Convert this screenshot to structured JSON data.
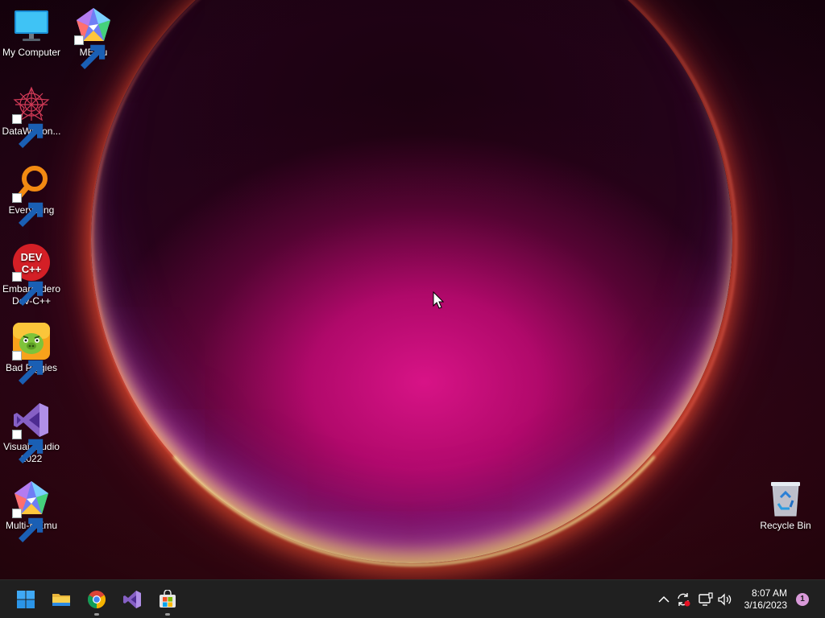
{
  "desktop": {
    "icons": [
      {
        "label": "My Computer",
        "icon": "monitor-icon",
        "shortcut": false
      },
      {
        "label": "MEmu",
        "icon": "memu-icon",
        "shortcut": true
      },
      {
        "label": "DataWagon...",
        "icon": "datawagon-icon",
        "shortcut": true
      },
      {
        "label": "Everything",
        "icon": "everything-search-icon",
        "shortcut": true
      },
      {
        "label": "Embarcadero Dev-C++",
        "icon": "devcpp-icon",
        "shortcut": true,
        "logo_text": "DEV C++"
      },
      {
        "label": "Bad Piggies",
        "icon": "bad-piggies-icon",
        "shortcut": true
      },
      {
        "label": "Visual Studio 2022",
        "icon": "visual-studio-icon",
        "shortcut": true
      },
      {
        "label": "Multi-MEmu",
        "icon": "multi-memu-icon",
        "shortcut": true
      },
      {
        "label": "Recycle Bin",
        "icon": "recycle-bin-icon",
        "shortcut": false
      }
    ]
  },
  "taskbar": {
    "pinned": [
      {
        "name": "Start",
        "icon": "windows-start-icon",
        "running": false
      },
      {
        "name": "File Explorer",
        "icon": "folder-icon",
        "running": false
      },
      {
        "name": "Google Chrome",
        "icon": "chrome-icon",
        "running": true
      },
      {
        "name": "Visual Studio",
        "icon": "visual-studio-icon",
        "running": false
      },
      {
        "name": "Microsoft Store",
        "icon": "store-icon",
        "running": true
      }
    ],
    "tray": {
      "icons": [
        "chevron-up-icon",
        "sync-icon",
        "network-icon",
        "volume-icon"
      ],
      "time": "8:07 AM",
      "date": "3/16/2023",
      "notification_count": "1"
    }
  },
  "colors": {
    "taskbar_bg": "#202020",
    "accent": "#d99ad9"
  }
}
